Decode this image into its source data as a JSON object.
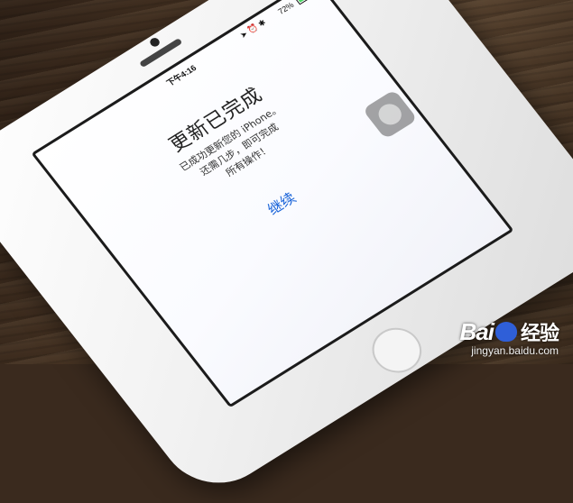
{
  "status_bar": {
    "time": "下午4:16",
    "battery_percent": "72%",
    "battery_level": 0.72
  },
  "dialog": {
    "title": "更新已完成",
    "message_lines": [
      "已成功更新您的 iPhone。",
      "还需几步，即可完成",
      "所有操作！"
    ],
    "continue_label": "继续"
  },
  "watermark": {
    "logo_text": "Bai",
    "logo_text2": "经验",
    "url": "jingyan.baidu.com"
  },
  "colors": {
    "link": "#1a64d9",
    "phone_body": "#f1f1f1"
  }
}
